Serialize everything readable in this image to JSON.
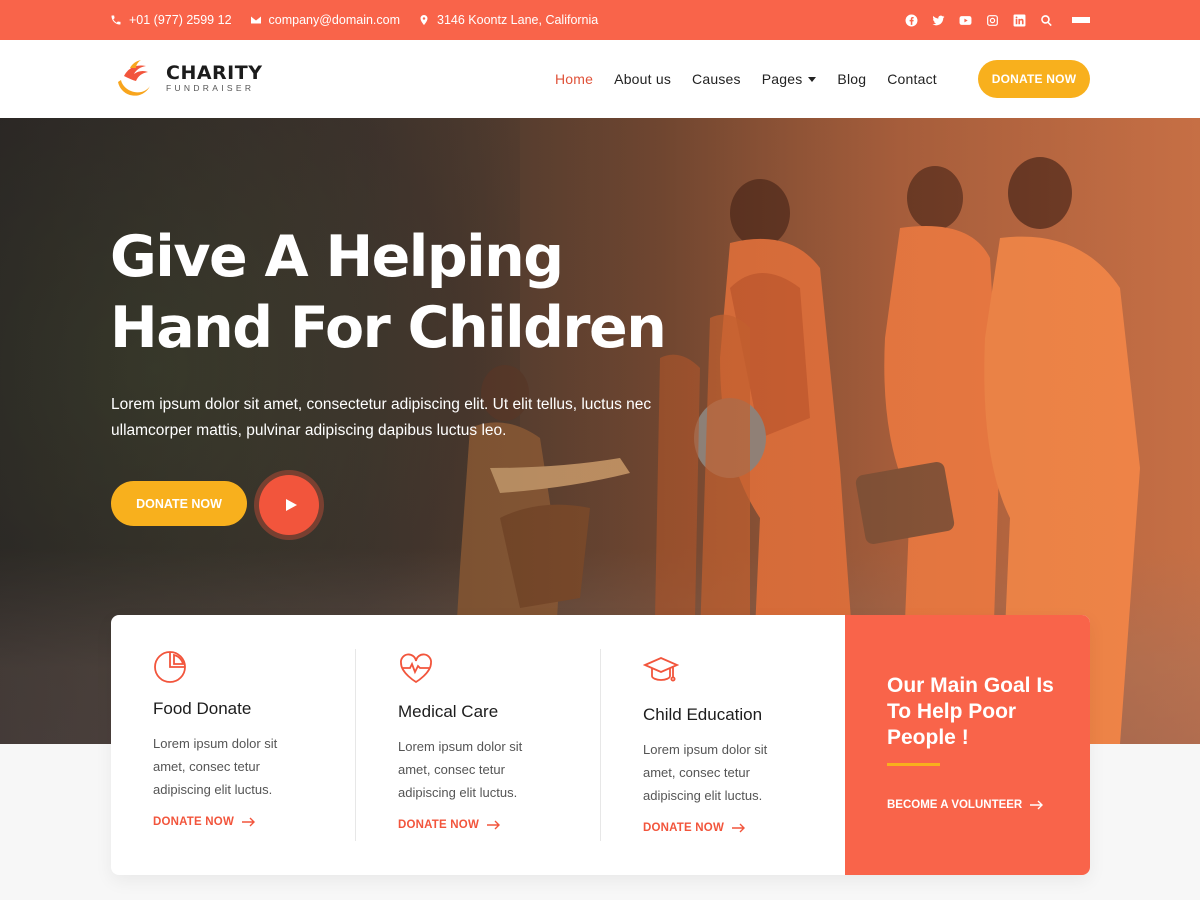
{
  "topbar": {
    "phone": "+01 (977) 2599 12",
    "email": "company@domain.com",
    "address": "3146 Koontz Lane, California",
    "social_icons": [
      "facebook-icon",
      "twitter-icon",
      "youtube-icon",
      "instagram-icon",
      "linkedin-icon",
      "search-icon",
      "menu-icon"
    ]
  },
  "header": {
    "logo_title": "CHARITY",
    "logo_subtitle": "FUNDRAISER",
    "nav": [
      "Home",
      "About us",
      "Causes",
      "Pages",
      "Blog",
      "Contact"
    ],
    "active_nav": "Home",
    "donate_label": "DONATE NOW"
  },
  "hero": {
    "title_line1": "Give A Helping",
    "title_line2": "Hand For Children",
    "text": "Lorem ipsum dolor sit amet, consectetur adipiscing elit. Ut elit tellus, luctus nec ullamcorper mattis, pulvinar adipiscing dapibus luctus leo.",
    "donate_label": "DONATE NOW",
    "play_icon": "play-icon"
  },
  "features": [
    {
      "icon": "pie-chart-icon",
      "title": "Food Donate",
      "desc": "Lorem ipsum dolor sit amet, consec tetur adipiscing elit  luctus.",
      "link": "DONATE NOW"
    },
    {
      "icon": "heart-pulse-icon",
      "title": "Medical Care",
      "desc": "Lorem ipsum dolor sit amet, consec tetur adipiscing elit  luctus.",
      "link": "DONATE NOW"
    },
    {
      "icon": "graduation-cap-icon",
      "title": "Child Education",
      "desc": "Lorem ipsum dolor sit amet, consec tetur adipiscing elit  luctus.",
      "link": "DONATE NOW"
    }
  ],
  "goal": {
    "title": "Our Main Goal Is To Help Poor People !",
    "link": "BECOME A VOLUNTEER"
  },
  "colors": {
    "accent": "#f9644a",
    "button_yellow": "#f8b01d",
    "link_red": "#f2553c"
  }
}
